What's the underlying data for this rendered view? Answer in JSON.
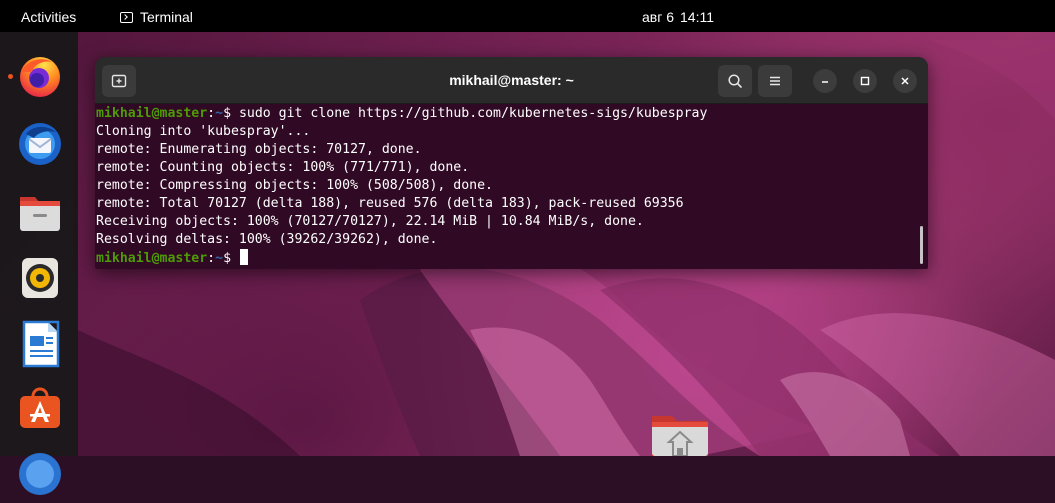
{
  "topbar": {
    "activities": "Activities",
    "app_name": "Terminal",
    "date": "авг 6",
    "time": "14:11"
  },
  "dock": {
    "items": [
      {
        "icon": "firefox-icon",
        "running": true
      },
      {
        "icon": "thunderbird-icon",
        "running": false
      },
      {
        "icon": "files-icon",
        "running": false
      },
      {
        "icon": "rhythmbox-icon",
        "running": false
      },
      {
        "icon": "libreoffice-writer-icon",
        "running": false
      },
      {
        "icon": "ubuntu-software-icon",
        "running": false
      },
      {
        "icon": "help-icon",
        "running": false
      }
    ]
  },
  "terminal": {
    "title": "mikhail@master: ~",
    "prompt_user": "mikhail@master",
    "prompt_path": "~",
    "command": "sudo git clone https://github.com/kubernetes-sigs/kubespray",
    "output": [
      "Cloning into 'kubespray'...",
      "remote: Enumerating objects: 70127, done.",
      "remote: Counting objects: 100% (771/771), done.",
      "remote: Compressing objects: 100% (508/508), done.",
      "remote: Total 70127 (delta 188), reused 576 (delta 183), pack-reused 69356",
      "Receiving objects: 100% (70127/70127), 22.14 MiB | 10.84 MiB/s, done.",
      "Resolving deltas: 100% (39262/39262), done."
    ]
  },
  "colors": {
    "terminal_bg": "#300a24",
    "prompt_user": "#4e9a06",
    "prompt_path": "#3465a4",
    "accent": "#e95420"
  }
}
